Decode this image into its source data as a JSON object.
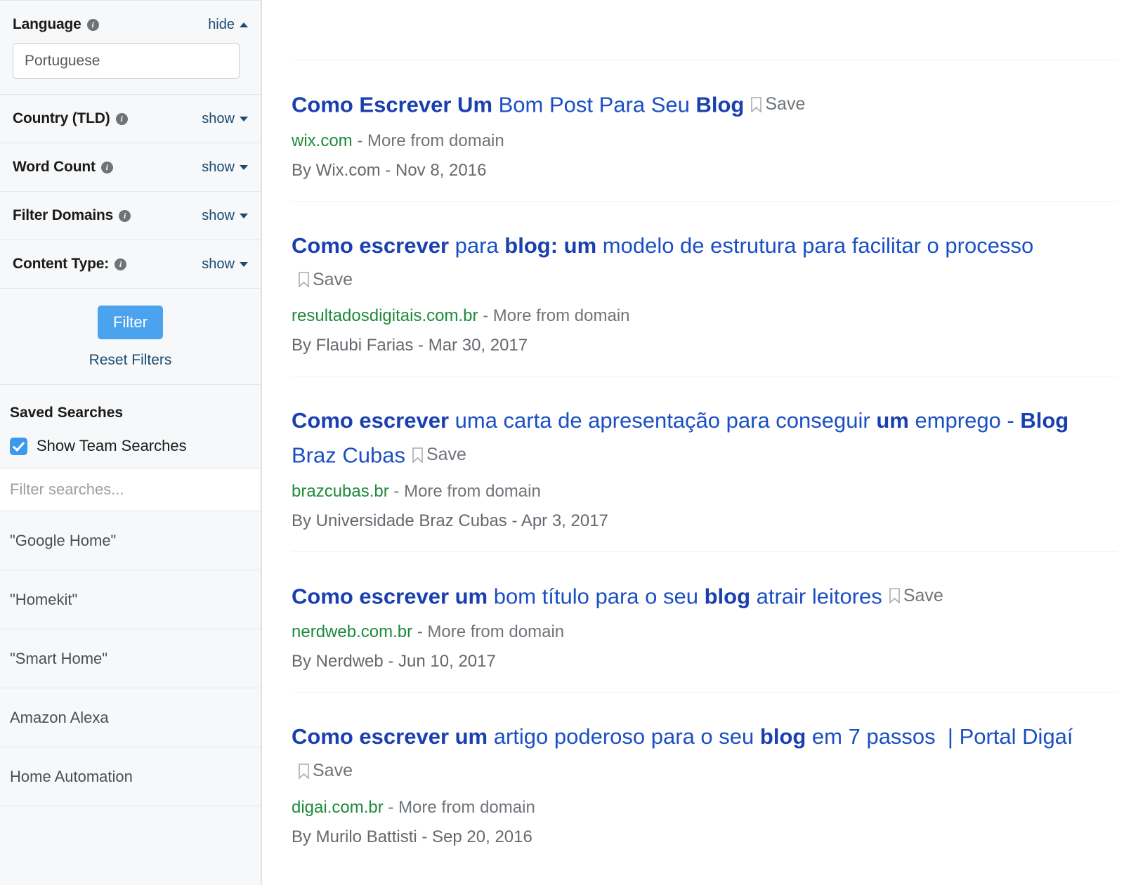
{
  "sidebar": {
    "filters": [
      {
        "title": "Language",
        "info_icon": "info-icon",
        "toggle_label": "hide",
        "toggle_state": "expanded",
        "caret": "caret-up-icon",
        "input_value": "Portuguese"
      },
      {
        "title": "Country (TLD)",
        "info_icon": "info-icon",
        "toggle_label": "show",
        "toggle_state": "collapsed",
        "caret": "caret-down-icon"
      },
      {
        "title": "Word Count",
        "info_icon": "info-icon",
        "toggle_label": "show",
        "toggle_state": "collapsed",
        "caret": "caret-down-icon"
      },
      {
        "title": "Filter Domains",
        "info_icon": "info-icon",
        "toggle_label": "show",
        "toggle_state": "collapsed",
        "caret": "caret-down-icon"
      },
      {
        "title": "Content Type:",
        "info_icon": "info-icon",
        "toggle_label": "show",
        "toggle_state": "collapsed",
        "caret": "caret-down-icon"
      }
    ],
    "actions": {
      "filter_button": "Filter",
      "reset_link": "Reset Filters"
    },
    "saved_searches": {
      "heading": "Saved Searches",
      "team_checkbox_label": "Show Team Searches",
      "team_checkbox_checked": true,
      "filter_placeholder": "Filter searches...",
      "items": [
        "\"Google Home\"",
        "\"Homekit\"",
        "\"Smart Home\"",
        "Amazon Alexa",
        "Home Automation"
      ]
    }
  },
  "results": {
    "save_label": "Save",
    "more_from_domain": "More from domain",
    "separator": " - ",
    "items": [
      {
        "title_parts": [
          {
            "text": "Como Escrever Um",
            "bold": true
          },
          {
            "text": " Bom Post Para Seu ",
            "bold": false
          },
          {
            "text": "Blog",
            "bold": true
          }
        ],
        "domain": "wix.com",
        "byline": "By Wix.com - Nov 8, 2016"
      },
      {
        "title_parts": [
          {
            "text": "Como escrever",
            "bold": true
          },
          {
            "text": " para ",
            "bold": false
          },
          {
            "text": "blog: um",
            "bold": true
          },
          {
            "text": " modelo de estrutura para facilitar o processo",
            "bold": false
          }
        ],
        "domain": "resultadosdigitais.com.br",
        "byline": "By Flaubi Farias - Mar 30, 2017"
      },
      {
        "title_parts": [
          {
            "text": "Como escrever",
            "bold": true
          },
          {
            "text": " uma carta de apresentação para conseguir ",
            "bold": false
          },
          {
            "text": "um",
            "bold": true
          },
          {
            "text": " emprego - ",
            "bold": false
          },
          {
            "text": "Blog",
            "bold": true
          },
          {
            "text": " Braz Cubas",
            "bold": false
          }
        ],
        "domain": "brazcubas.br",
        "byline": "By Universidade Braz Cubas - Apr 3, 2017"
      },
      {
        "title_parts": [
          {
            "text": "Como escrever um",
            "bold": true
          },
          {
            "text": " bom título para o seu ",
            "bold": false
          },
          {
            "text": "blog",
            "bold": true
          },
          {
            "text": " atrair leitores",
            "bold": false
          }
        ],
        "domain": "nerdweb.com.br",
        "byline": "By Nerdweb - Jun 10, 2017"
      },
      {
        "title_parts": [
          {
            "text": "Como escrever um",
            "bold": true
          },
          {
            "text": " artigo poderoso para o seu ",
            "bold": false
          },
          {
            "text": "blog",
            "bold": true
          },
          {
            "text": " em 7 passos  | Portal Digaí",
            "bold": false
          }
        ],
        "domain": "digai.com.br",
        "byline": "By Murilo Battisti - Sep 20, 2016"
      }
    ]
  },
  "colors": {
    "link_blue": "#1a4fc4",
    "domain_green": "#1d8a3a",
    "accent_blue": "#4ba3f0",
    "muted_gray": "#6f7479",
    "sidebar_bg": "#f7f8f9"
  }
}
